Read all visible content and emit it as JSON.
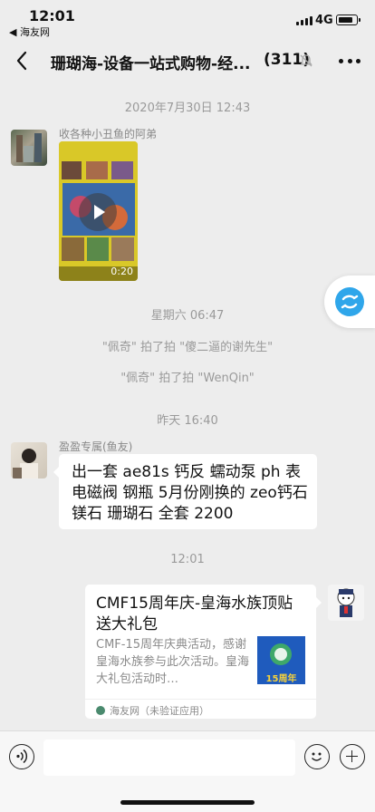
{
  "status_bar": {
    "time": "12:01",
    "back_app": "◀ 海友网",
    "network": "4G"
  },
  "nav": {
    "title": "珊瑚海-设备一站式购物-经...",
    "member_count": "(311)"
  },
  "messages": {
    "ts1": "2020年7月30日 12:43",
    "msg1_sender": "收各种小丑鱼的阿弟",
    "msg1_video_duration": "0:20",
    "ts2": "星期六 06:47",
    "sys1": "\"佩奇\" 拍了拍 \"傻二逼的谢先生\"",
    "sys2": "\"佩奇\" 拍了拍 \"WenQin\"",
    "ts3": "昨天 16:40",
    "msg2_sender": "盈盈专属(鱼友)",
    "msg2_text": "出一套 ae81s 钙反  蠕动泵 ph 表 电磁阀 钢瓶  5月份刚换的 zeo钙石 镁石 珊瑚石 全套 2200",
    "ts4": "12:01",
    "link_title": "CMF15周年庆-皇海水族顶贴送大礼包",
    "link_desc": "CMF-15周年庆典活动，感谢皇海水族参与此次活动。皇海大礼包活动时…",
    "link_source": "海友网（未验证应用）",
    "link_thumb_text": "15周年"
  },
  "colors": {
    "background": "#ededed",
    "bubble": "#ffffff",
    "timestamp": "#9a9a9a",
    "floating_accent": "#2fa6ea"
  }
}
